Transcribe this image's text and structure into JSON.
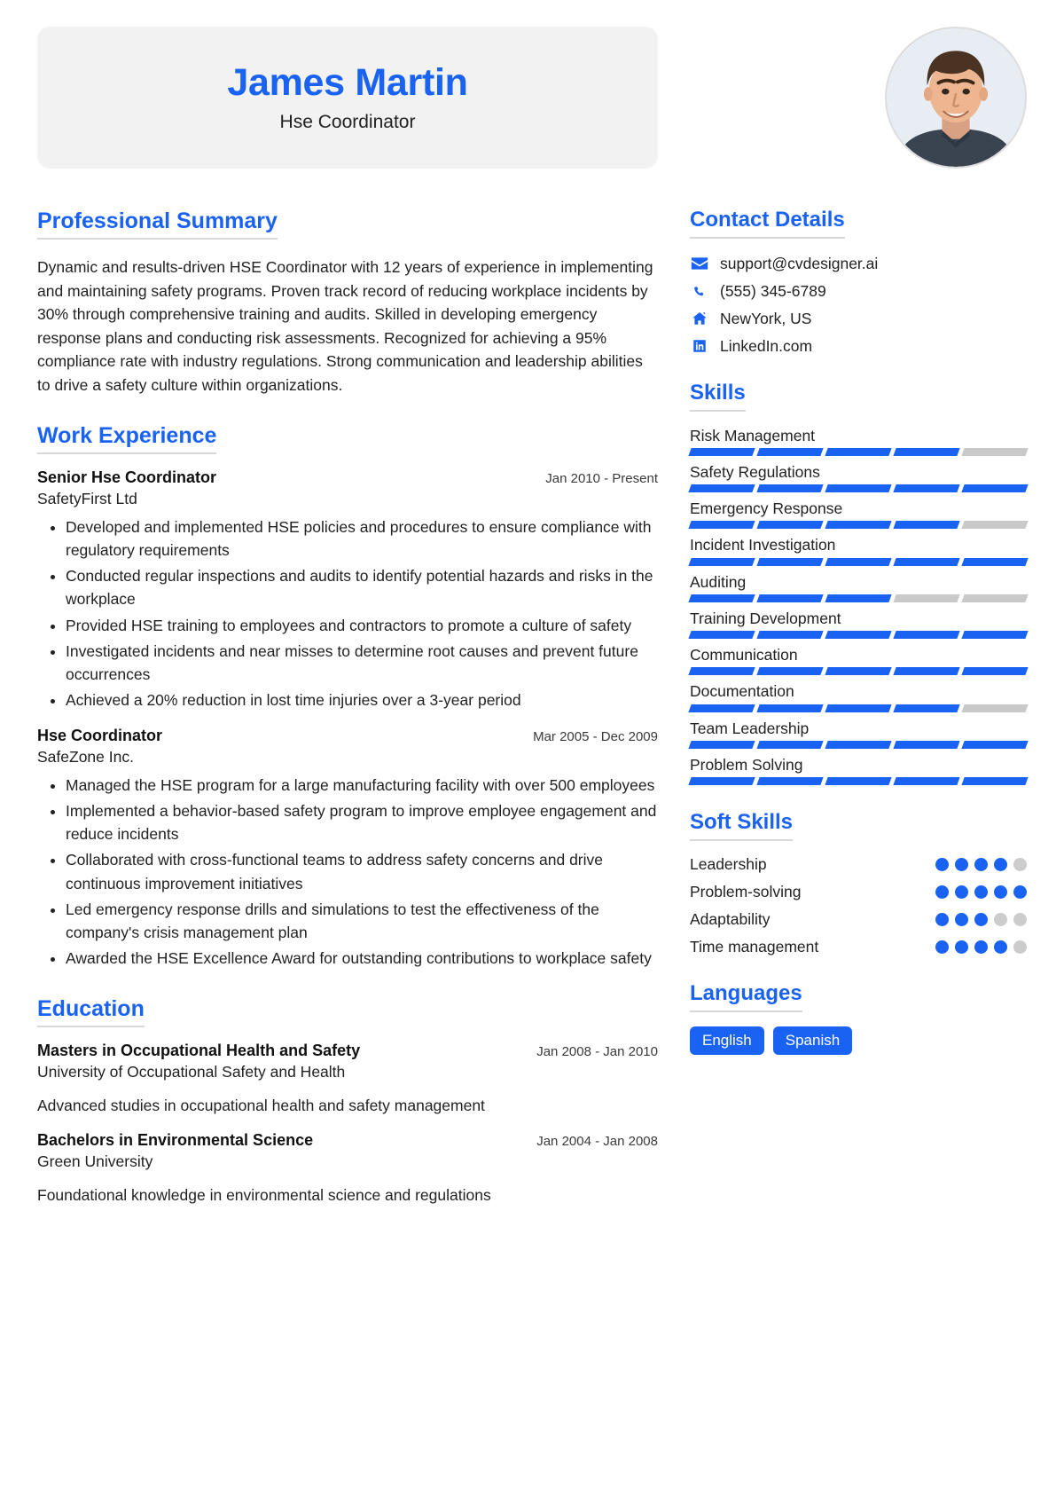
{
  "colors": {
    "accent": "#1a62f2",
    "banner_bg": "#f2f2f2",
    "rule": "#d8d8d8",
    "muted_bar": "#c9c9c9",
    "muted_dot": "#cccccc",
    "text": "#222222"
  },
  "header": {
    "name": "James Martin",
    "title": "Hse Coordinator",
    "avatar_icon": "portrait-photo"
  },
  "summary": {
    "heading": "Professional Summary",
    "text": "Dynamic and results-driven HSE Coordinator with 12 years of experience in implementing and maintaining safety programs. Proven track record of reducing workplace incidents by 30% through comprehensive training and audits. Skilled in developing emergency response plans and conducting risk assessments. Recognized for achieving a 95% compliance rate with industry regulations. Strong communication and leadership abilities to drive a safety culture within organizations."
  },
  "experience": {
    "heading": "Work Experience",
    "entries": [
      {
        "role": "Senior Hse Coordinator",
        "company": "SafetyFirst Ltd",
        "date": "Jan 2010 - Present",
        "bullets": [
          "Developed and implemented HSE policies and procedures to ensure compliance with regulatory requirements",
          "Conducted regular inspections and audits to identify potential hazards and risks in the workplace",
          "Provided HSE training to employees and contractors to promote a culture of safety",
          "Investigated incidents and near misses to determine root causes and prevent future occurrences",
          "Achieved a 20% reduction in lost time injuries over a 3-year period"
        ]
      },
      {
        "role": "Hse Coordinator",
        "company": "SafeZone Inc.",
        "date": "Mar 2005 - Dec 2009",
        "bullets": [
          "Managed the HSE program for a large manufacturing facility with over 500 employees",
          "Implemented a behavior-based safety program to improve employee engagement and reduce incidents",
          "Collaborated with cross-functional teams to address safety concerns and drive continuous improvement initiatives",
          "Led emergency response drills and simulations to test the effectiveness of the company's crisis management plan",
          "Awarded the HSE Excellence Award for outstanding contributions to workplace safety"
        ]
      }
    ]
  },
  "education": {
    "heading": "Education",
    "entries": [
      {
        "degree": "Masters in Occupational Health and Safety",
        "school": "University of Occupational Safety and Health",
        "date": "Jan 2008 - Jan 2010",
        "description": "Advanced studies in occupational health and safety management"
      },
      {
        "degree": "Bachelors in Environmental Science",
        "school": "Green University",
        "date": "Jan 2004 - Jan 2008",
        "description": "Foundational knowledge in environmental science and regulations"
      }
    ]
  },
  "contact": {
    "heading": "Contact Details",
    "items": [
      {
        "icon": "envelope-icon",
        "value": "support@cvdesigner.ai"
      },
      {
        "icon": "phone-icon",
        "value": "(555) 345-6789"
      },
      {
        "icon": "home-icon",
        "value": "NewYork, US"
      },
      {
        "icon": "linkedin-icon",
        "value": "LinkedIn.com"
      }
    ]
  },
  "skills": {
    "heading": "Skills",
    "max": 5,
    "items": [
      {
        "name": "Risk Management",
        "level": 4
      },
      {
        "name": "Safety Regulations",
        "level": 5
      },
      {
        "name": "Emergency Response",
        "level": 4
      },
      {
        "name": "Incident Investigation",
        "level": 5
      },
      {
        "name": "Auditing",
        "level": 3
      },
      {
        "name": "Training Development",
        "level": 5
      },
      {
        "name": "Communication",
        "level": 5
      },
      {
        "name": "Documentation",
        "level": 4
      },
      {
        "name": "Team Leadership",
        "level": 5
      },
      {
        "name": "Problem Solving",
        "level": 5
      }
    ]
  },
  "soft_skills": {
    "heading": "Soft Skills",
    "max": 5,
    "items": [
      {
        "name": "Leadership",
        "level": 4
      },
      {
        "name": "Problem-solving",
        "level": 5
      },
      {
        "name": "Adaptability",
        "level": 3
      },
      {
        "name": "Time management",
        "level": 4
      }
    ]
  },
  "languages": {
    "heading": "Languages",
    "items": [
      "English",
      "Spanish"
    ]
  }
}
